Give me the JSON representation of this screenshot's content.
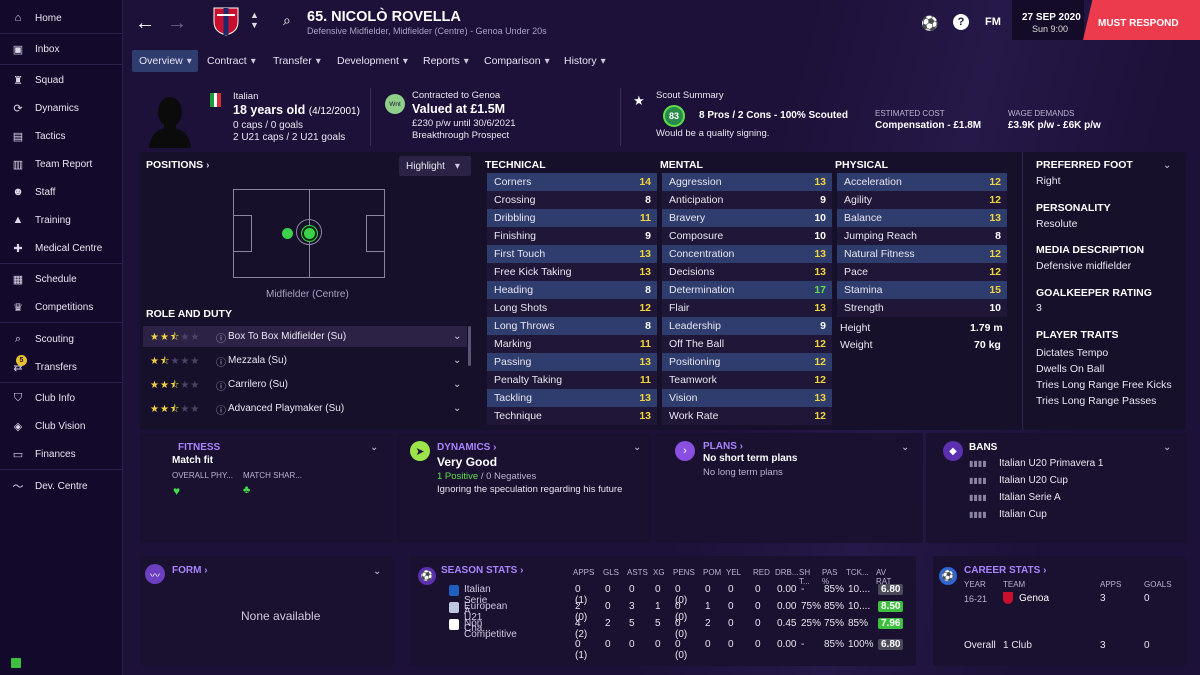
{
  "sidebar": {
    "items": [
      {
        "label": "Home",
        "icon": "home-icon"
      },
      {
        "label": "Inbox",
        "icon": "inbox-icon"
      },
      {
        "label": "Squad",
        "icon": "squad-icon"
      },
      {
        "label": "Dynamics",
        "icon": "dynamics-icon"
      },
      {
        "label": "Tactics",
        "icon": "tactics-icon"
      },
      {
        "label": "Team Report",
        "icon": "report-icon"
      },
      {
        "label": "Staff",
        "icon": "staff-icon"
      },
      {
        "label": "Training",
        "icon": "training-icon"
      },
      {
        "label": "Medical Centre",
        "icon": "medical-icon"
      },
      {
        "label": "Schedule",
        "icon": "calendar-icon"
      },
      {
        "label": "Competitions",
        "icon": "trophy-icon"
      },
      {
        "label": "Scouting",
        "icon": "scouting-icon"
      },
      {
        "label": "Transfers",
        "icon": "transfers-icon",
        "badge": "5"
      },
      {
        "label": "Club Info",
        "icon": "shield-icon"
      },
      {
        "label": "Club Vision",
        "icon": "vision-icon"
      },
      {
        "label": "Finances",
        "icon": "finances-icon"
      },
      {
        "label": "Dev. Centre",
        "icon": "devcentre-icon"
      }
    ]
  },
  "header": {
    "player_title": "65. NICOLÒ ROVELLA",
    "subtitle": "Defensive Midfielder, Midfielder (Centre) - Genoa Under 20s",
    "fm": "FM",
    "date": "27 SEP 2020",
    "time": "Sun 9:00",
    "must_respond": "MUST RESPOND"
  },
  "tabs": [
    "Overview",
    "Contract",
    "Transfer",
    "Development",
    "Reports",
    "Comparison",
    "History"
  ],
  "profile": {
    "nationality": "Italian",
    "age": "18 years old",
    "dob": "(4/12/2001)",
    "caps": "0 caps / 0 goals",
    "u21": "2 U21 caps / 2 U21 goals",
    "contract_label": "Contracted to Genoa",
    "value": "Valued at £1.5M",
    "wage": "£230 p/w until 30/6/2021",
    "prospect": "Breakthrough Prospect",
    "wnt": "Wnt",
    "scout_label": "Scout Summary",
    "scout_score": "83",
    "scout_summary": "8 Pros / 2 Cons - 100% Scouted",
    "scout_note": "Would be a quality signing.",
    "est_cost_label": "ESTIMATED COST",
    "est_cost": "Compensation - £1.8M",
    "wage_label": "WAGE DEMANDS",
    "wage_demands": "£3.9K p/w - £6K p/w"
  },
  "positions": {
    "title": "POSITIONS",
    "highlight": "Highlight",
    "position_label": "Midfielder (Centre)",
    "role_title": "ROLE AND DUTY",
    "roles": [
      {
        "name": "Box To Box Midfielder (Su)"
      },
      {
        "name": "Mezzala (Su)"
      },
      {
        "name": "Carrilero (Su)"
      },
      {
        "name": "Advanced Playmaker (Su)"
      }
    ]
  },
  "technical": {
    "title": "TECHNICAL",
    "attrs": [
      {
        "name": "Corners",
        "value": "14"
      },
      {
        "name": "Crossing",
        "value": "8"
      },
      {
        "name": "Dribbling",
        "value": "11"
      },
      {
        "name": "Finishing",
        "value": "9"
      },
      {
        "name": "First Touch",
        "value": "13"
      },
      {
        "name": "Free Kick Taking",
        "value": "13"
      },
      {
        "name": "Heading",
        "value": "8"
      },
      {
        "name": "Long Shots",
        "value": "12"
      },
      {
        "name": "Long Throws",
        "value": "8"
      },
      {
        "name": "Marking",
        "value": "11"
      },
      {
        "name": "Passing",
        "value": "13"
      },
      {
        "name": "Penalty Taking",
        "value": "11"
      },
      {
        "name": "Tackling",
        "value": "13"
      },
      {
        "name": "Technique",
        "value": "13"
      }
    ]
  },
  "mental": {
    "title": "MENTAL",
    "attrs": [
      {
        "name": "Aggression",
        "value": "13"
      },
      {
        "name": "Anticipation",
        "value": "9"
      },
      {
        "name": "Bravery",
        "value": "10"
      },
      {
        "name": "Composure",
        "value": "10"
      },
      {
        "name": "Concentration",
        "value": "13"
      },
      {
        "name": "Decisions",
        "value": "13"
      },
      {
        "name": "Determination",
        "value": "17"
      },
      {
        "name": "Flair",
        "value": "13"
      },
      {
        "name": "Leadership",
        "value": "9"
      },
      {
        "name": "Off The Ball",
        "value": "12"
      },
      {
        "name": "Positioning",
        "value": "12"
      },
      {
        "name": "Teamwork",
        "value": "12"
      },
      {
        "name": "Vision",
        "value": "13"
      },
      {
        "name": "Work Rate",
        "value": "12"
      }
    ]
  },
  "physical": {
    "title": "PHYSICAL",
    "attrs": [
      {
        "name": "Acceleration",
        "value": "12"
      },
      {
        "name": "Agility",
        "value": "12"
      },
      {
        "name": "Balance",
        "value": "13"
      },
      {
        "name": "Jumping Reach",
        "value": "8"
      },
      {
        "name": "Natural Fitness",
        "value": "12"
      },
      {
        "name": "Pace",
        "value": "12"
      },
      {
        "name": "Stamina",
        "value": "15"
      },
      {
        "name": "Strength",
        "value": "10"
      }
    ],
    "height_label": "Height",
    "height": "1.79 m",
    "weight_label": "Weight",
    "weight": "70 kg"
  },
  "info": {
    "foot_label": "PREFERRED FOOT",
    "foot": "Right",
    "personality_label": "PERSONALITY",
    "personality": "Resolute",
    "media_label": "MEDIA DESCRIPTION",
    "media": "Defensive midfielder",
    "gk_label": "GOALKEEPER RATING",
    "gk": "3",
    "traits_label": "PLAYER TRAITS",
    "traits": [
      "Dictates Tempo",
      "Dwells On Ball",
      "Tries Long Range Free Kicks",
      "Tries Long Range Passes"
    ]
  },
  "fitness": {
    "title": "FITNESS",
    "status": "Match fit",
    "overall": "OVERALL PHY...",
    "sharp": "MATCH SHAR..."
  },
  "dynamics": {
    "title": "DYNAMICS",
    "status": "Very Good",
    "positive": "1 Positive",
    "sep": " / ",
    "negative": "0 Negatives",
    "note": "Ignoring the speculation regarding his future"
  },
  "plans": {
    "title": "PLANS",
    "short": "No short term plans",
    "long": "No long term plans"
  },
  "bans": {
    "title": "BANS",
    "items": [
      "Italian U20 Primavera 1",
      "Italian U20 Cup",
      "Italian Serie A",
      "Italian Cup"
    ]
  },
  "form": {
    "title": "FORM",
    "empty": "None available"
  },
  "season": {
    "title": "SEASON STATS",
    "cols": [
      "APPS",
      "GLS",
      "ASTS",
      "XG",
      "PENS",
      "POM",
      "YEL",
      "RED",
      "DRB...",
      "SH T...",
      "PAS %",
      "TCK...",
      "AV RAT"
    ],
    "rows": [
      {
        "comp": "Italian Serie A",
        "vals": [
          "0 (1)",
          "0",
          "0",
          "0",
          "0 (0)",
          "0",
          "0",
          "0",
          "0.00",
          "-",
          "85%",
          "10....",
          "6.80"
        ],
        "rat_color": "#4a4a5a"
      },
      {
        "comp": "European U21 Cha...",
        "vals": [
          "2 (0)",
          "0",
          "3",
          "1",
          "0 (0)",
          "1",
          "0",
          "0",
          "0.00",
          "75%",
          "85%",
          "10....",
          "8.50"
        ],
        "rat_color": "#3fbf3f"
      },
      {
        "comp": "Non Competitive",
        "vals": [
          "4 (2)",
          "2",
          "5",
          "5",
          "0 (0)",
          "2",
          "0",
          "0",
          "0.45",
          "25%",
          "75%",
          "85%",
          "7.96"
        ],
        "rat_color": "#3fbf3f"
      }
    ],
    "total": [
      "0 (1)",
      "0",
      "0",
      "0",
      "0 (0)",
      "0",
      "0",
      "0",
      "0.00",
      "-",
      "85%",
      "100%",
      "6.80"
    ]
  },
  "career": {
    "title": "CAREER STATS",
    "cols": [
      "YEAR",
      "TEAM",
      "APPS",
      "GOALS"
    ],
    "rows": [
      {
        "year": "16-21",
        "team": "Genoa",
        "apps": "3",
        "goals": "0"
      }
    ],
    "overall_label": "Overall",
    "overall_team": "1 Club",
    "overall_apps": "3",
    "overall_goals": "0"
  },
  "colors": {
    "accent": "#a984ff",
    "yellow": "#f2d53c",
    "green": "#5fe04a",
    "respond": "#ec3b4c"
  }
}
